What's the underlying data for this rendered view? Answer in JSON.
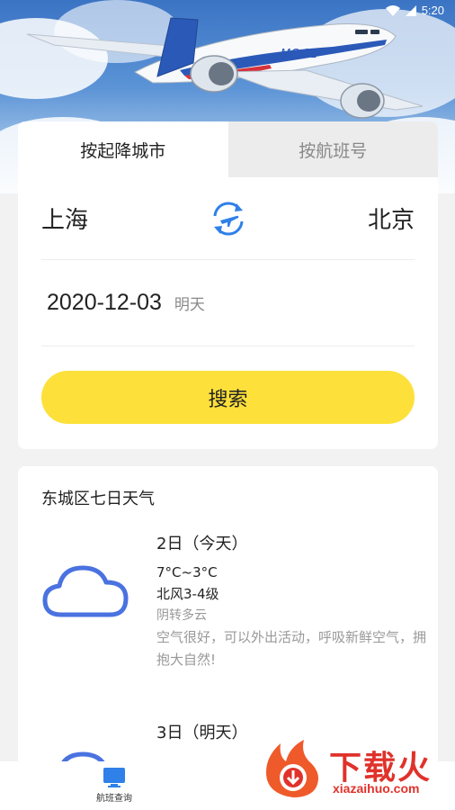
{
  "status_bar": {
    "time": "5:20"
  },
  "hero": {
    "plane_label": "MC-21"
  },
  "search": {
    "tabs": [
      {
        "label": "按起降城市"
      },
      {
        "label": "按航班号"
      }
    ],
    "from_city": "上海",
    "to_city": "北京",
    "date": "2020-12-03",
    "date_hint": "明天",
    "search_label": "搜索"
  },
  "weather": {
    "title": "东城区七日天气",
    "days": [
      {
        "date": "2日（今天）",
        "temp": "7°C~3°C",
        "wind": "北风3-4级",
        "condition": "阴转多云",
        "tip": "空气很好，可以外出活动，呼吸新鲜空气，拥抱大自然!"
      },
      {
        "date": "3日（明天）"
      }
    ]
  },
  "nav": {
    "item_label": "航班查询"
  },
  "watermark": {
    "text": "下载火",
    "url": "xiazaihuo.com"
  },
  "colors": {
    "accent": "#fde03a",
    "icon_blue": "#2f80e8",
    "cloud_icon": "#4a72e0"
  }
}
